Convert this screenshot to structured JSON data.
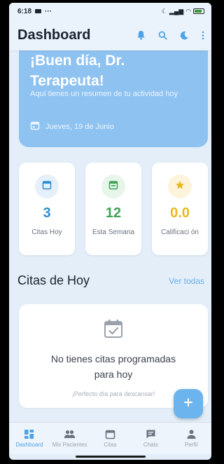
{
  "status_bar": {
    "time": "6:18",
    "indicators": "···"
  },
  "header": {
    "title": "Dashboard"
  },
  "hero": {
    "greeting": "¡Buen día, Dr. Terapeuta!",
    "subtitle": "Aquí tienes un resumen de tu actividad hoy",
    "date": "Jueves, 19 de Junio"
  },
  "stats": [
    {
      "value": "3",
      "label": "Citas Hoy",
      "color": "#2e8fd1",
      "icon_bg": "#e6f0fb",
      "icon": "calendar-icon"
    },
    {
      "value": "12",
      "label": "Esta Semana",
      "color": "#3fa356",
      "icon_bg": "#e7f5ea",
      "icon": "calendar-week-icon"
    },
    {
      "value": "0.0",
      "label": "Calificaci ón",
      "color": "#e8b81e",
      "icon_bg": "#fdf4dc",
      "icon": "star-icon"
    }
  ],
  "appointments": {
    "title": "Citas de Hoy",
    "see_all": "Ver todas",
    "empty_title": "No tienes citas programadas para hoy",
    "empty_subtitle": "¡Perfecto día para descansar!"
  },
  "nav": [
    {
      "label": "Dashboard",
      "active": true
    },
    {
      "label": "Mis Pacientes",
      "active": false
    },
    {
      "label": "Citas",
      "active": false
    },
    {
      "label": "Chats",
      "active": false
    },
    {
      "label": "Perfil",
      "active": false
    }
  ],
  "colors": {
    "accent": "#4da3e6",
    "hero": "#8ec2f1",
    "background": "#e3eef9"
  }
}
